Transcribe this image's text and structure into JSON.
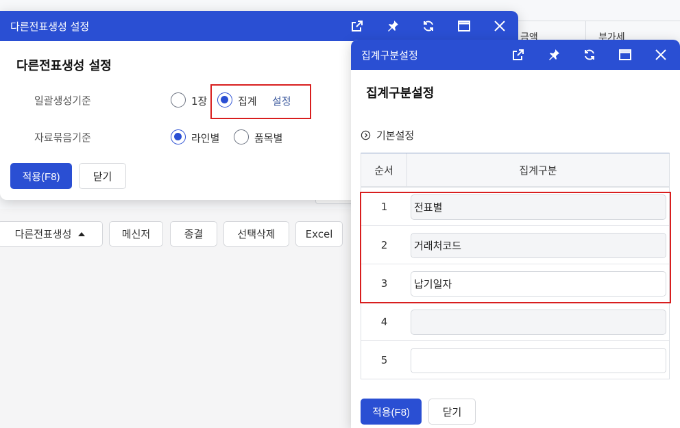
{
  "background": {
    "header_cells": [
      "금액",
      "부가세"
    ],
    "toolbar": [
      {
        "label": "다른전표생성",
        "has_caret": true
      },
      {
        "label": "메신저"
      },
      {
        "label": "종결"
      },
      {
        "label": "선택삭제"
      },
      {
        "label": "Excel"
      }
    ]
  },
  "dialog_left": {
    "title": "다른전표생성 설정",
    "heading": "다른전표생성 설정",
    "rows": [
      {
        "label": "일괄생성기준",
        "options": [
          {
            "label": "1장",
            "checked": false
          },
          {
            "label": "집계",
            "checked": true
          }
        ],
        "link": "설정"
      },
      {
        "label": "자료묶음기준",
        "options": [
          {
            "label": "라인별",
            "checked": true
          },
          {
            "label": "품목별",
            "checked": false
          }
        ]
      }
    ],
    "apply_label": "적용(F8)",
    "close_label": "닫기"
  },
  "dialog_right": {
    "title": "집계구분설정",
    "heading": "집계구분설정",
    "section_label": "기본설정",
    "grid": {
      "col_order": "순서",
      "col_group": "집계구분",
      "rows": [
        {
          "num": "1",
          "value": "전표별"
        },
        {
          "num": "2",
          "value": "거래처코드"
        },
        {
          "num": "3",
          "value": "납기일자"
        },
        {
          "num": "4",
          "value": ""
        },
        {
          "num": "5",
          "value": ""
        }
      ]
    },
    "apply_label": "적용(F8)",
    "close_label": "닫기"
  },
  "titlebar_icons": [
    "external-link-icon",
    "pin-icon",
    "refresh-icon",
    "maximize-icon",
    "close-icon"
  ],
  "colors": {
    "primary": "#2a4fd3",
    "highlight": "#d81e1e"
  }
}
